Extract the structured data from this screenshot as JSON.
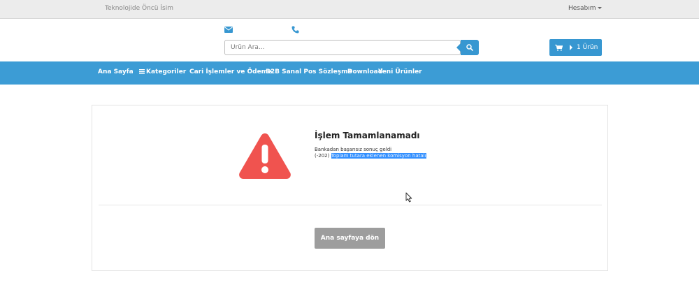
{
  "topbar": {
    "tagline": "Teknolojide Öncü İsim",
    "account_label": "Hesabım"
  },
  "header": {
    "search": {
      "placeholder": "Ürün Ara...",
      "value": ""
    },
    "cart": {
      "label": "1 Ürün"
    }
  },
  "nav": {
    "items": [
      {
        "label": "Ana Sayfa"
      },
      {
        "label": "Kategoriler"
      },
      {
        "label": "Cari İşlemler ve Ödeme"
      },
      {
        "label": "B2B Sanal Pos Sözleşme"
      },
      {
        "label": "Download"
      },
      {
        "label": "Yeni Ürünler"
      }
    ]
  },
  "result": {
    "title": "İşlem Tamamlanamadı",
    "line1": "Bankadan başarısız sonuç geldi",
    "code": "(-202)",
    "error_text": "Toplam tutara eklenen komisyon hatalı",
    "home_button": "Ana sayfaya dön"
  },
  "colors": {
    "accent": "#3c9cd5",
    "warning": "#f0534f",
    "button_gray": "#9d9d9d",
    "selection": "#3390ff"
  },
  "icons": {
    "mail": "envelope-icon",
    "phone": "phone-icon",
    "search": "search-icon",
    "cart": "cart-icon",
    "menu": "bars-icon",
    "alert": "warning-triangle-icon"
  }
}
